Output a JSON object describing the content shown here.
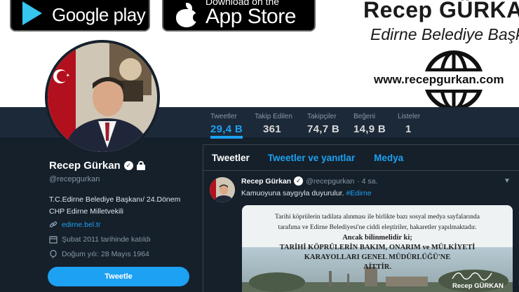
{
  "banner": {
    "google_play": {
      "label": "Google play",
      "icon": "play-triangle-icon"
    },
    "app_store": {
      "small_label": "Download on the",
      "label": "App Store",
      "icon": "apple-icon"
    },
    "promo": {
      "name": "Recep GÜRKA",
      "title": "Edirne Belediye Başk",
      "url": "www.recepgurkan.com",
      "icon": "globe-icon"
    }
  },
  "nav": {
    "stats": [
      {
        "label": "Tweetler",
        "value": "29,4 B"
      },
      {
        "label": "Takip Edilen",
        "value": "361"
      },
      {
        "label": "Takipçiler",
        "value": "74,7 B"
      },
      {
        "label": "Beğeni",
        "value": "14,9 B"
      },
      {
        "label": "Listeler",
        "value": "1"
      }
    ],
    "active_color": "#1da1f2"
  },
  "profile": {
    "name": "Recep Gürkan",
    "handle": "@recepgurkan",
    "bio_line1": "T.C.Edirne Belediye Başkanı/ 24.Dönem",
    "bio_line2": "CHP Edirne Milletvekili",
    "website": "edirne.bel.tr",
    "joined": "Şubat 2011 tarihinde katıldı",
    "birth": "Doğum yılı: 28 Mayıs 1964",
    "tweet_button": "Tweetle"
  },
  "timeline": {
    "tabs": [
      "Tweetler",
      "Tweetler ve yanıtlar",
      "Medya"
    ],
    "tweet": {
      "name": "Recep Gürkan",
      "handle": "@recepgurkan",
      "time": "· 4 sa.",
      "text": "Kamuoyuna saygıyla duyurulur.",
      "hashtag": "#Edirne",
      "media": {
        "line1": "Tarihi köprülerin tadilata alınması ile birlikte bazı sosyal medya sayfalarında",
        "line2": "tarafıma ve Edirne Belediyesi'ne ciddi eleştiriler, hakaretler yapılmaktadır.",
        "line3": "Ancak bilinmelidir ki;",
        "line4": "TARİHİ KÖPRÜLERİN BAKIM, ONARIM ve MÜLKİYETİ",
        "line5": "KARAYOLLARI GENEL MÜDÜRLÜĞÜ'NE",
        "line6": "AİTTİR.",
        "signature_name": "Recep GÜRKAN"
      }
    }
  },
  "colors": {
    "background": "#15202b",
    "navbar": "#1c2938",
    "accent": "#1da1f2",
    "muted": "#8899a6"
  }
}
